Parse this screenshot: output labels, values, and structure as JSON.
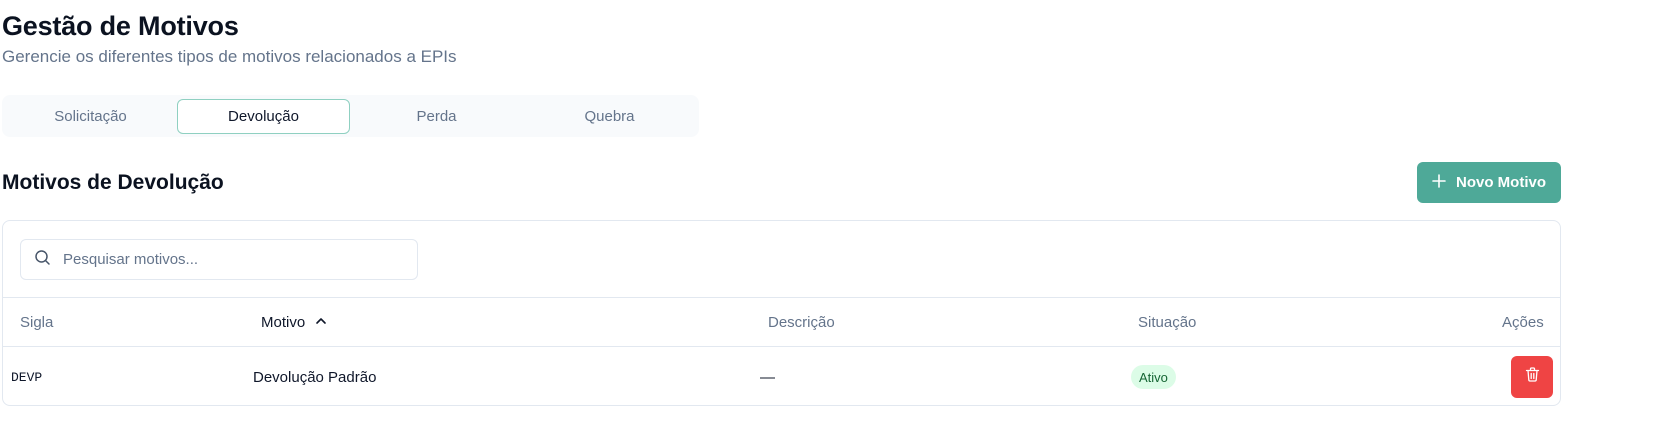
{
  "header": {
    "title": "Gestão de Motivos",
    "subtitle": "Gerencie os diferentes tipos de motivos relacionados a EPIs"
  },
  "tabs": [
    {
      "label": "Solicitação",
      "active": false
    },
    {
      "label": "Devolução",
      "active": true
    },
    {
      "label": "Perda",
      "active": false
    },
    {
      "label": "Quebra",
      "active": false
    }
  ],
  "section": {
    "title": "Motivos de Devolução",
    "new_button_label": "Novo Motivo",
    "new_button_icon": "plus-icon"
  },
  "search": {
    "placeholder": "Pesquisar motivos...",
    "value": "",
    "icon": "search-icon"
  },
  "table": {
    "columns": [
      "Sigla",
      "Motivo",
      "Descrição",
      "Situação",
      "Ações"
    ],
    "sorted_column": "Motivo",
    "sort_direction": "asc",
    "rows": [
      {
        "sigla": "DEVP",
        "motivo": "Devolução Padrão",
        "descricao": "—",
        "situacao": "Ativo",
        "action_icon": "trash-icon"
      }
    ]
  },
  "colors": {
    "accent": "#4ea998",
    "active_tab_border": "#8fd0c1",
    "danger": "#ef4444",
    "status_active_bg": "#dcfce7",
    "status_active_text": "#166534",
    "muted_text": "#64748b"
  }
}
